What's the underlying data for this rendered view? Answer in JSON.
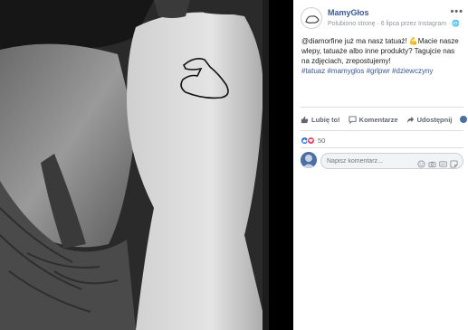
{
  "post": {
    "page_name": "MamyGłos",
    "meta_text": "Polubiono stronę · 6 lipca przez Instagram · ",
    "more_label": "•••",
    "text_lines": [
      "@diamorfine już ma nasz tatuaż! 💪Macie nasze",
      "wlepy, tatuaże albo inne produkty? Tagujcie nas",
      "na zdjęciach, zrepostujemy!"
    ],
    "hashtags": "#tatuaz #mamyglos #grlpwr #dziewczyny"
  },
  "actions": {
    "like_label": "Lubię to!",
    "comment_label": "Komentarze",
    "share_label": "Udostępnij"
  },
  "reactions": {
    "count": "50"
  },
  "comment": {
    "placeholder": "Napisz komentarz..."
  },
  "colors": {
    "link": "#385898",
    "like": "#1877f2",
    "love": "#f33e58"
  }
}
